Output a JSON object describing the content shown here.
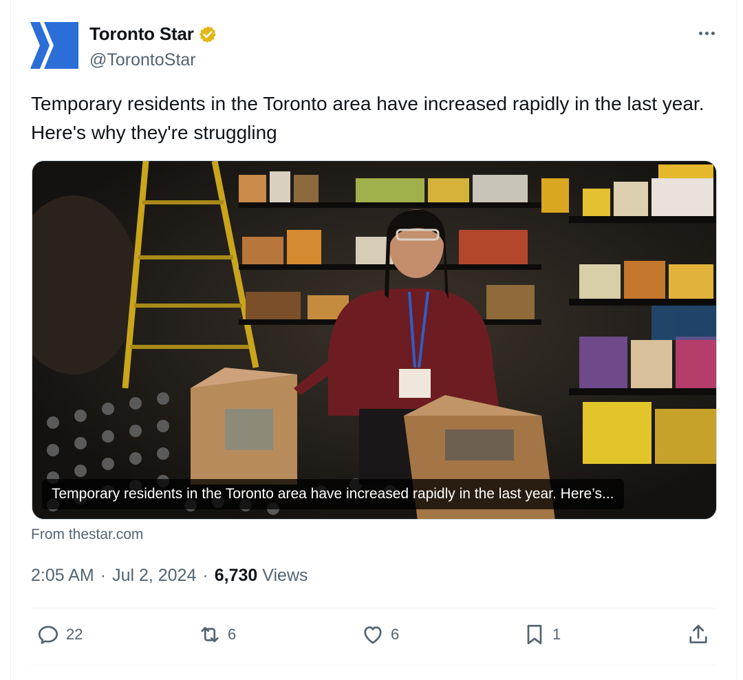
{
  "author": {
    "name": "Toronto Star",
    "handle": "@TorontoStar",
    "verified_color": "#e2b719",
    "avatar_color": "#2b6ed8"
  },
  "tweet": {
    "text": "Temporary residents in the Toronto area have increased rapidly in the last year. Here's why they're struggling"
  },
  "media": {
    "caption": "Temporary residents in the Toronto area have increased rapidly in the last year. Here’s...",
    "source": "From thestar.com"
  },
  "meta": {
    "time": "2:05 AM",
    "separator": "·",
    "date": "Jul 2, 2024",
    "views_count": "6,730",
    "views_label": "Views"
  },
  "actions": {
    "replies": "22",
    "reposts": "6",
    "likes": "6",
    "bookmarks": "1"
  },
  "icons": [
    "more-icon",
    "verified-icon",
    "reply-icon",
    "repost-icon",
    "like-icon",
    "bookmark-icon",
    "share-icon"
  ]
}
